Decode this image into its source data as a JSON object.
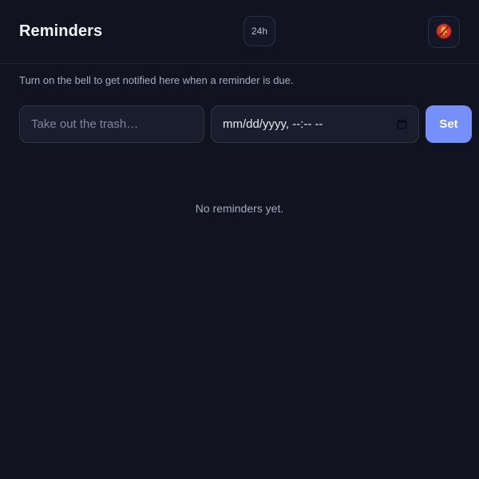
{
  "header": {
    "title": "Reminders",
    "time_format_label": "24h",
    "bell_icon": "bell-off-icon"
  },
  "hint": "Turn on the bell to get notified here when a reminder is due.",
  "form": {
    "task_placeholder": "Take out the trash…",
    "task_value": "",
    "datetime_display": "mm/dd/yyyy, --:-- --",
    "calendar_icon": "calendar-icon",
    "set_label": "Set"
  },
  "list": {
    "empty_message": "No reminders yet."
  },
  "colors": {
    "background": "#111420",
    "accent": "#7590fb",
    "bell_off": "#d7352b"
  }
}
